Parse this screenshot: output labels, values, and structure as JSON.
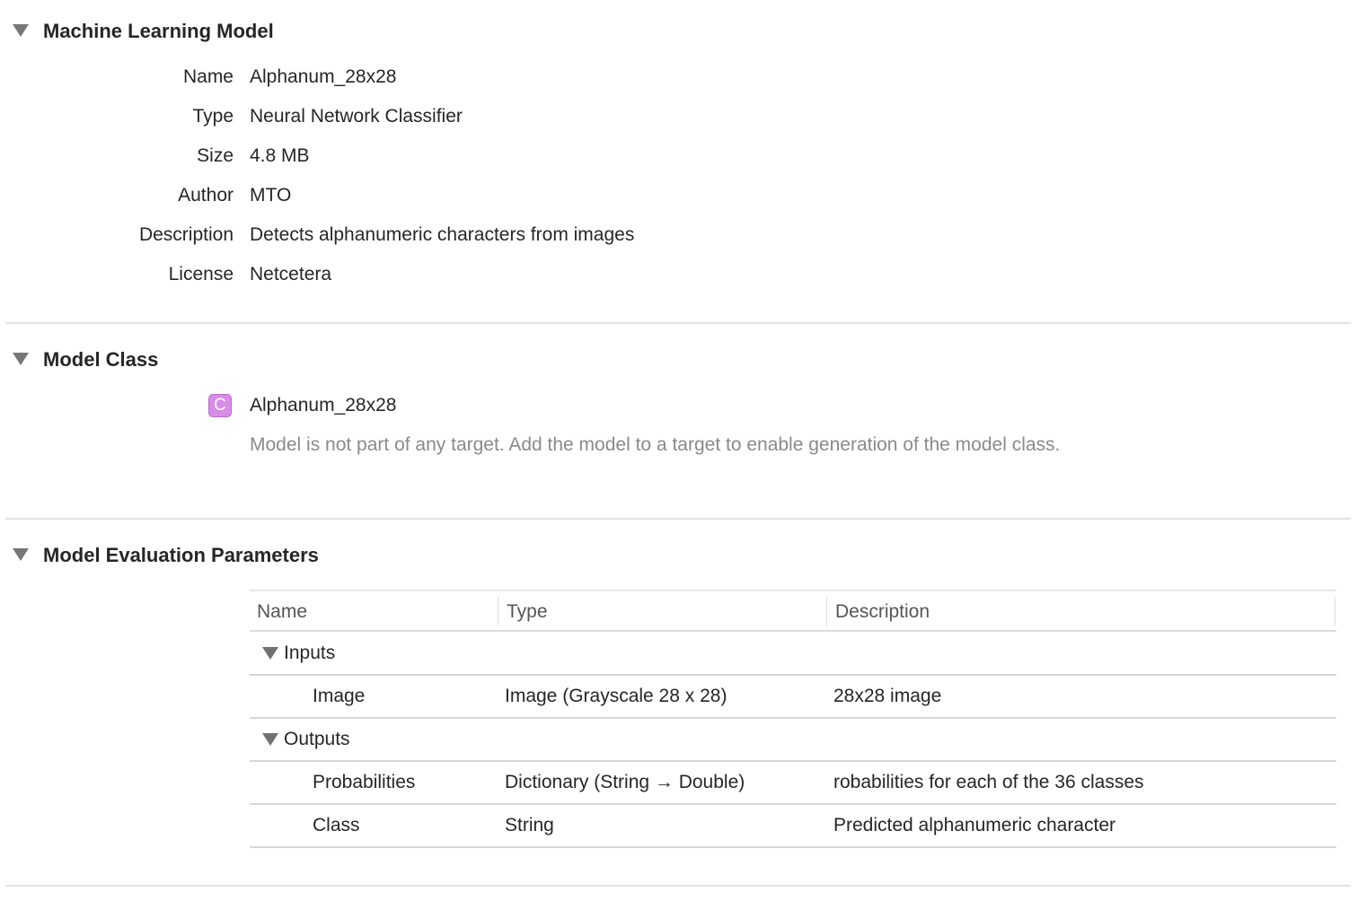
{
  "sections": {
    "ml_model": {
      "title": "Machine Learning Model",
      "properties": [
        {
          "label": "Name",
          "value": "Alphanum_28x28"
        },
        {
          "label": "Type",
          "value": "Neural Network Classifier"
        },
        {
          "label": "Size",
          "value": "4.8 MB"
        },
        {
          "label": "Author",
          "value": "MTO"
        },
        {
          "label": "Description",
          "value": "Detects alphanumeric characters from images"
        },
        {
          "label": "License",
          "value": "Netcetera"
        }
      ]
    },
    "model_class": {
      "title": "Model Class",
      "icon_letter": "C",
      "icon_color": "#d98be8",
      "class_name": "Alphanum_28x28",
      "note": "Model is not part of any target. Add the model to a target to enable generation of the model class."
    },
    "eval_params": {
      "title": "Model Evaluation Parameters",
      "columns": [
        "Name",
        "Type",
        "Description"
      ],
      "groups": [
        {
          "label": "Inputs",
          "rows": [
            {
              "name": "Image",
              "type": "Image (Grayscale 28 x 28)",
              "description": "28x28 image"
            }
          ]
        },
        {
          "label": "Outputs",
          "rows": [
            {
              "name": "Probabilities",
              "type": "Dictionary (String → Double)",
              "description": "robabilities for each of the 36 classes"
            },
            {
              "name": "Class",
              "type": "String",
              "description": "Predicted alphanumeric character"
            }
          ]
        }
      ]
    }
  }
}
